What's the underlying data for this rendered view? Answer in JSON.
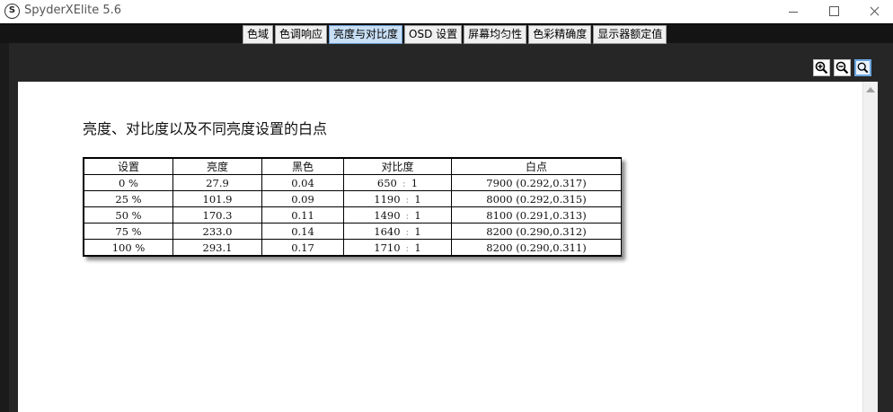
{
  "window": {
    "title": "SpyderXElite 5.6",
    "logo_letter": "S"
  },
  "tabs": [
    {
      "label": "色域"
    },
    {
      "label": "色调响应"
    },
    {
      "label": "亮度与对比度",
      "active": true
    },
    {
      "label": "OSD 设置"
    },
    {
      "label": "屏幕均匀性"
    },
    {
      "label": "色彩精确度"
    },
    {
      "label": "显示器额定值"
    }
  ],
  "toolbar": {
    "zoom_in_icon": "zoom-in-icon",
    "zoom_out_icon": "zoom-out-icon",
    "zoom_fit_icon": "zoom-fit-icon"
  },
  "report": {
    "title": "亮度、对比度以及不同亮度设置的白点",
    "columns": [
      "设置",
      "亮度",
      "黑色",
      "对比度",
      "白点"
    ],
    "rows": [
      {
        "setting": "0 %",
        "luminance": "27.9",
        "black": "0.04",
        "contrast_a": "650",
        "contrast_sep": ":",
        "contrast_b": "1",
        "whitepoint": "7900 (0.292,0.317)"
      },
      {
        "setting": "25 %",
        "luminance": "101.9",
        "black": "0.09",
        "contrast_a": "1190",
        "contrast_sep": ":",
        "contrast_b": "1",
        "whitepoint": "8000 (0.292,0.315)"
      },
      {
        "setting": "50 %",
        "luminance": "170.3",
        "black": "0.11",
        "contrast_a": "1490",
        "contrast_sep": ":",
        "contrast_b": "1",
        "whitepoint": "8100 (0.291,0.313)"
      },
      {
        "setting": "75 %",
        "luminance": "233.0",
        "black": "0.14",
        "contrast_a": "1640",
        "contrast_sep": ":",
        "contrast_b": "1",
        "whitepoint": "8200 (0.290,0.312)"
      },
      {
        "setting": "100 %",
        "luminance": "293.1",
        "black": "0.17",
        "contrast_a": "1710",
        "contrast_sep": ":",
        "contrast_b": "1",
        "whitepoint": "8200 (0.290,0.311)"
      }
    ]
  },
  "colors": {
    "active_tab": "#c8dff5",
    "app_background": "#262626"
  }
}
